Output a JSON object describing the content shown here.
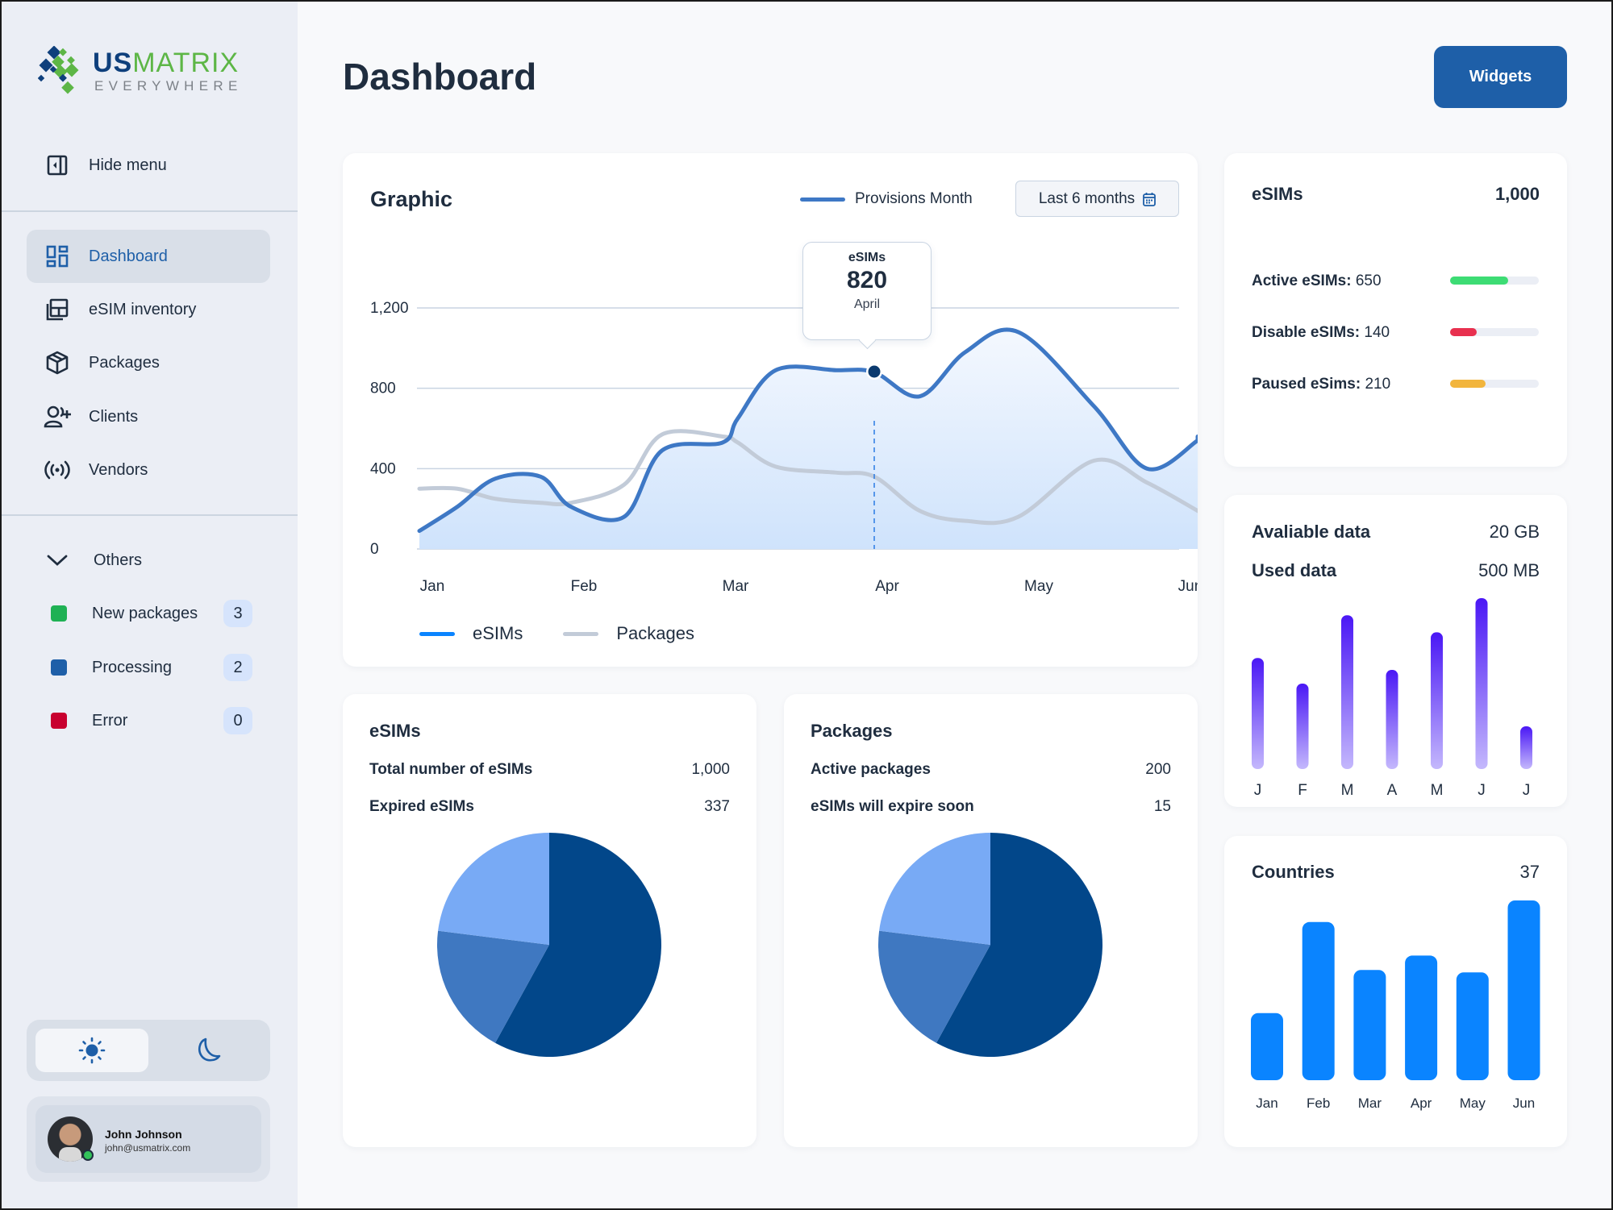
{
  "brand": {
    "name_part1": "US",
    "name_part2": "MATRIX",
    "tagline": "EVERYWHERE"
  },
  "sidebar": {
    "hide_menu_label": "Hide menu",
    "items": [
      {
        "label": "Dashboard",
        "icon": "dashboard-icon",
        "active": true
      },
      {
        "label": "eSIM inventory",
        "icon": "inventory-icon",
        "active": false
      },
      {
        "label": "Packages",
        "icon": "package-icon",
        "active": false
      },
      {
        "label": "Clients",
        "icon": "add-user-icon",
        "active": false
      },
      {
        "label": "Vendors",
        "icon": "broadcast-icon",
        "active": false
      }
    ],
    "others_label": "Others",
    "status_items": [
      {
        "label": "New packages",
        "count": "3",
        "color": "#1FB154"
      },
      {
        "label": "Processing",
        "count": "2",
        "color": "#1E5FA8"
      },
      {
        "label": "Error",
        "count": "0",
        "color": "#C8002F"
      }
    ],
    "theme": {
      "selected": "light",
      "options": [
        "light",
        "dark"
      ]
    },
    "user": {
      "name": "John Johnson",
      "email": "john@usmatrix.com",
      "status": "online"
    }
  },
  "header": {
    "title": "Dashboard",
    "widgets_label": "Widgets"
  },
  "graphic_card": {
    "title": "Graphic",
    "legend_label": "Provisions Month",
    "range_label": "Last 6 months",
    "tooltip": {
      "series": "eSIMs",
      "value": "820",
      "month": "April"
    },
    "bottom_legend": [
      "eSIMs",
      "Packages"
    ]
  },
  "esims_card": {
    "title": "eSIMs",
    "rows": [
      {
        "label": "Total number of eSIMs",
        "value": "1,000"
      },
      {
        "label": "Expired eSIMs",
        "value": "337"
      }
    ]
  },
  "packages_card": {
    "title": "Packages",
    "rows": [
      {
        "label": "Active packages",
        "value": "200"
      },
      {
        "label": "eSIMs will expire soon",
        "value": "15"
      }
    ]
  },
  "esims_status_card": {
    "title": "eSIMs",
    "total": "1,000",
    "rows": [
      {
        "label": "Active eSIMs:",
        "value": "650",
        "fraction": 0.65,
        "color": "#3DDC74"
      },
      {
        "label": "Disable eSIMs:",
        "value": "140",
        "fraction": 0.3,
        "color": "#E8304F"
      },
      {
        "label": "Paused eSims:",
        "value": "210",
        "fraction": 0.4,
        "color": "#F2B53D"
      }
    ]
  },
  "data_card": {
    "available_label": "Avaliable data",
    "available_value": "20 GB",
    "used_label": "Used data",
    "used_value": "500 MB"
  },
  "countries_card": {
    "title": "Countries",
    "value": "37"
  },
  "chart_data": [
    {
      "type": "area",
      "title": "Graphic",
      "categories": [
        "Jan",
        "Feb",
        "Mar",
        "Apr",
        "May",
        "Jun"
      ],
      "ylim": [
        0,
        1200
      ],
      "yticks": [
        "0",
        "400",
        "800",
        "1,200"
      ],
      "grid": true,
      "legend": "bottom-left",
      "x": [
        0,
        0.25,
        0.5,
        0.8,
        1.0,
        1.35,
        1.6,
        2.0,
        2.1,
        2.35,
        2.75,
        3.0,
        3.3,
        3.6,
        3.95,
        4.45,
        4.8,
        5.15,
        5.45,
        5.6
      ],
      "series": [
        {
          "name": "eSIMs",
          "color": "#3E78C5",
          "values": [
            90,
            210,
            350,
            360,
            210,
            160,
            490,
            530,
            650,
            890,
            890,
            880,
            760,
            980,
            1080,
            710,
            400,
            540,
            540,
            560
          ]
        },
        {
          "name": "Packages",
          "color": "#C2CBD8",
          "values": [
            300,
            300,
            250,
            230,
            230,
            320,
            570,
            560,
            530,
            410,
            380,
            360,
            190,
            140,
            160,
            440,
            330,
            190,
            190,
            190
          ]
        }
      ],
      "highlight": {
        "category": "Apr",
        "series": "eSIMs",
        "value": 820
      }
    },
    {
      "type": "pie",
      "title": "eSIMs",
      "slices": [
        {
          "label": "segment-1",
          "value": 58,
          "color": "#02478A"
        },
        {
          "label": "segment-2",
          "value": 19,
          "color": "#3F78C1"
        },
        {
          "label": "segment-3",
          "value": 23,
          "color": "#78AAF5"
        }
      ]
    },
    {
      "type": "pie",
      "title": "Packages",
      "slices": [
        {
          "label": "segment-1",
          "value": 58,
          "color": "#02478A"
        },
        {
          "label": "segment-2",
          "value": 19,
          "color": "#3F78C1"
        },
        {
          "label": "segment-3",
          "value": 23,
          "color": "#78AAF5"
        }
      ]
    },
    {
      "type": "bar",
      "title": "Used data",
      "categories": [
        "J",
        "F",
        "M",
        "A",
        "M",
        "J",
        "J"
      ],
      "values": [
        65,
        50,
        90,
        58,
        80,
        100,
        25
      ],
      "ylim": [
        0,
        100
      ]
    },
    {
      "type": "bar",
      "title": "Countries",
      "categories": [
        "Jan",
        "Feb",
        "Mar",
        "Apr",
        "May",
        "Jun"
      ],
      "values": [
        28,
        66,
        46,
        52,
        45,
        75
      ],
      "ylim": [
        0,
        75
      ]
    }
  ]
}
